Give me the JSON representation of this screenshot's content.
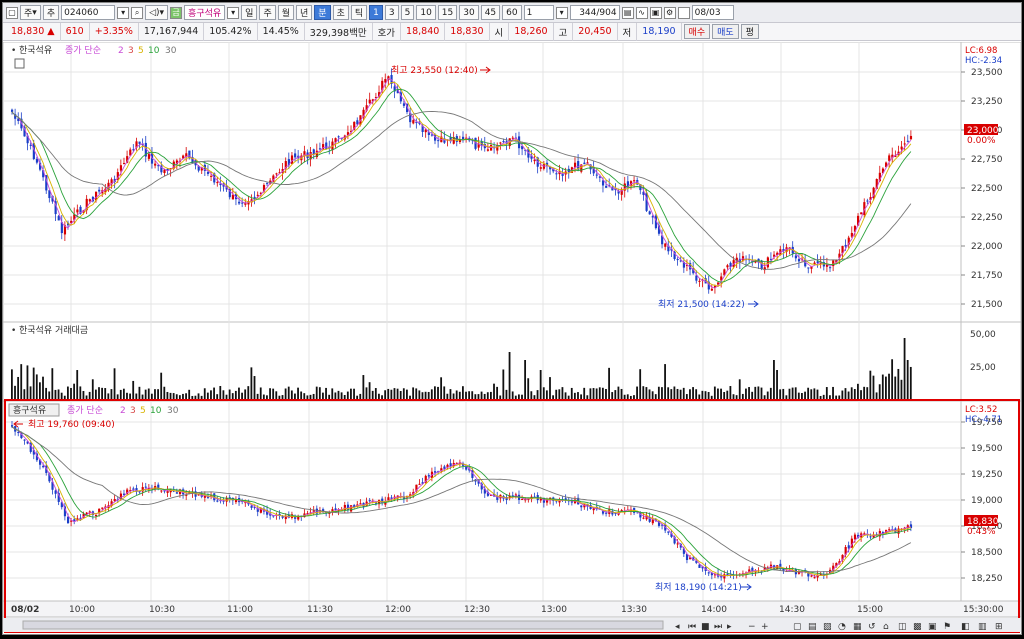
{
  "toolbar": {
    "chart_type": "주",
    "add_label": "추",
    "code": "024060",
    "stock_name": "흥구석유",
    "periods": [
      "일",
      "주",
      "월",
      "년",
      "분",
      "초",
      "틱"
    ],
    "selected_period": "분",
    "minutes": [
      "1",
      "3",
      "5",
      "10",
      "15",
      "30",
      "45",
      "60"
    ],
    "selected_minute": "1",
    "interval_value": "1",
    "count": "344",
    "count_total": "/904",
    "date": "08/03"
  },
  "quote": {
    "price": "18,830",
    "change_arrow": "▲",
    "change": "610",
    "rate": "+3.35%",
    "volume": "17,167,944",
    "volume_ratio": "105.42%",
    "turnover": "14.45%",
    "amount": "329,398백만",
    "bid_label": "호가",
    "bid1": "18,840",
    "bid2": "18,830",
    "open_label": "시",
    "open": "18,260",
    "high_label": "고",
    "high": "20,450",
    "low_label": "저",
    "low": "18,190",
    "buy_label": "매수",
    "sell_label": "매도",
    "flat_label": "평"
  },
  "panel1": {
    "name": "한국석유",
    "ma_label": "종가 단순",
    "ma_periods": [
      "2",
      "3",
      "5",
      "10",
      "30"
    ],
    "ma_colors": [
      "#c84bd6",
      "#d84a4a",
      "#d8b400",
      "#2aa23a",
      "#777777"
    ],
    "lc": "LC:6.98",
    "hc": "HC:-2.34",
    "y_ticks": [
      "23,500",
      "23,250",
      "23,000",
      "22,750",
      "22,500",
      "22,250",
      "22,000",
      "21,750",
      "21,500"
    ],
    "current_price": "23,000",
    "current_rate": "0.00%",
    "high_note": "최고 23,550 (12:40)",
    "low_note": "최저 21,500 (14:22)"
  },
  "volume_panel": {
    "name": "한국석유 거래대금",
    "y_ticks": [
      "50,00",
      "25,00"
    ]
  },
  "panel2": {
    "name": "흥구석유",
    "ma_label": "종가 단순",
    "ma_periods": [
      "2",
      "3",
      "5",
      "10",
      "30"
    ],
    "lc": "LC:3.52",
    "hc": "HC:-4.71",
    "y_ticks": [
      "19,750",
      "19,500",
      "19,250",
      "19,000",
      "18,750",
      "18,500",
      "18,250"
    ],
    "current_price": "18,830",
    "current_rate": "0.43%",
    "high_note": "최고 19,760 (09:40)",
    "low_note": "최저 18,190 (14:21)"
  },
  "x_axis": {
    "labels": [
      "08/02",
      "10:00",
      "10:30",
      "11:00",
      "11:30",
      "12:00",
      "12:30",
      "13:00",
      "13:30",
      "14:00",
      "14:30",
      "15:00",
      "15:30:00"
    ]
  },
  "colors": {
    "up": "#d80000",
    "down": "#1a3ec8",
    "highlight_border": "#e00000"
  }
}
